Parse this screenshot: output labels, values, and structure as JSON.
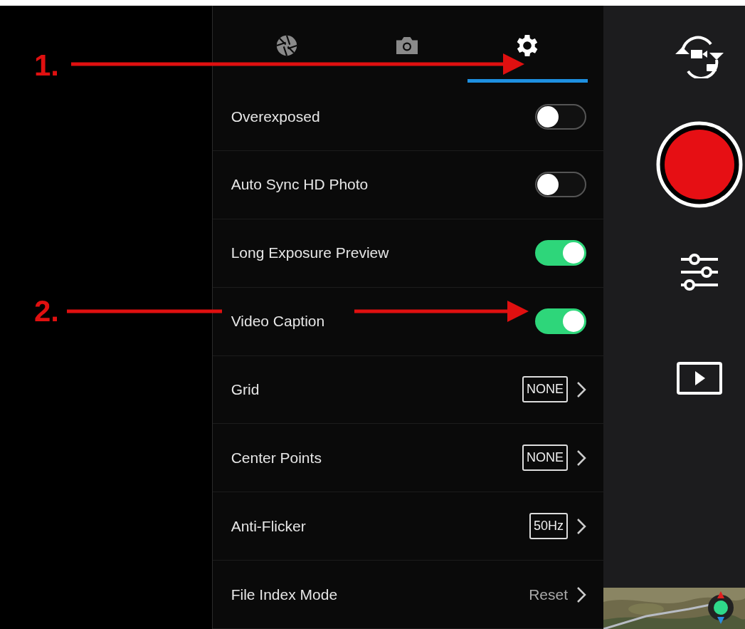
{
  "annotations": [
    {
      "label": "1."
    },
    {
      "label": "2."
    }
  ],
  "tabs": [
    {
      "kind": "aperture",
      "selected": false
    },
    {
      "kind": "camera",
      "selected": false
    },
    {
      "kind": "gear",
      "selected": true
    }
  ],
  "settings": [
    {
      "kind": "toggle",
      "label": "Overexposed",
      "on": false
    },
    {
      "kind": "toggle",
      "label": "Auto Sync HD Photo",
      "on": false
    },
    {
      "kind": "toggle",
      "label": "Long Exposure Preview",
      "on": true
    },
    {
      "kind": "toggle",
      "label": "Video Caption",
      "on": true
    },
    {
      "kind": "option",
      "label": "Grid",
      "value": "NONE"
    },
    {
      "kind": "option",
      "label": "Center Points",
      "value": "NONE"
    },
    {
      "kind": "option",
      "label": "Anti-Flicker",
      "value": "50Hz"
    },
    {
      "kind": "link",
      "label": "File Index Mode",
      "value": "Reset"
    }
  ],
  "side_controls": [
    {
      "kind": "switch-mode"
    },
    {
      "kind": "record"
    },
    {
      "kind": "adjust"
    },
    {
      "kind": "playback"
    }
  ]
}
